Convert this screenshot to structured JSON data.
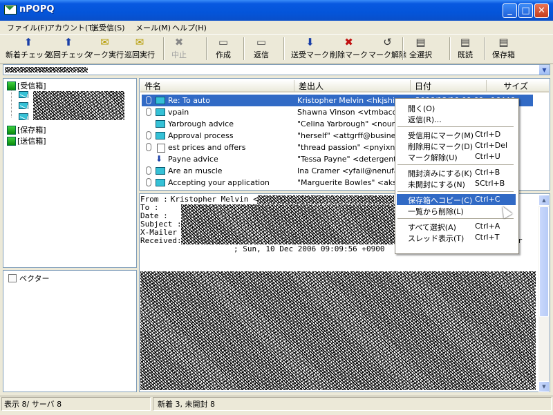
{
  "window": {
    "title": "nPOPQ",
    "minimize": "_",
    "maximize": "□",
    "close": "✕"
  },
  "menu": [
    "ファイル(F)",
    "アカウント(T)",
    "送受信(S)",
    "メール(M)",
    "ヘルプ(H)"
  ],
  "toolbar": [
    {
      "label": "新着チェック",
      "icon": "check-new-icon",
      "glyph": "⬆"
    },
    {
      "label": "巡回チェック",
      "icon": "round-check-icon",
      "glyph": "⬆"
    },
    {
      "label": "マーク実行",
      "icon": "execute-mark-icon",
      "glyph": "✉"
    },
    {
      "label": "巡回実行",
      "icon": "round-execute-icon",
      "glyph": "✉"
    },
    {
      "label": "中止",
      "icon": "stop-icon",
      "glyph": "✖",
      "disabled": true
    },
    {
      "label": "作成",
      "icon": "compose-icon",
      "glyph": "▭"
    },
    {
      "label": "返信",
      "icon": "reply-icon",
      "glyph": "▭"
    },
    {
      "label": "送受マーク",
      "icon": "send-receive-mark-icon",
      "glyph": "⬇"
    },
    {
      "label": "削除マーク",
      "icon": "delete-mark-icon",
      "glyph": "✖"
    },
    {
      "label": "マーク解除",
      "icon": "unmark-icon",
      "glyph": "↺"
    },
    {
      "label": "全選択",
      "icon": "select-all-icon",
      "glyph": "▤"
    },
    {
      "label": "既読",
      "icon": "mark-read-icon",
      "glyph": "▤"
    },
    {
      "label": "保存箱",
      "icon": "save-box-icon",
      "glyph": "▤"
    }
  ],
  "folders": {
    "inbox": "[受信箱]",
    "savebox": "[保存箱]",
    "outbox": "[送信箱]"
  },
  "vector_panel": {
    "label": "ベクター"
  },
  "list": {
    "columns": {
      "subject": "件名",
      "from": "差出人",
      "date": "日付",
      "size": "サイズ"
    },
    "rows": [
      {
        "attach": true,
        "icon": "mail",
        "subject": "Re: To auto",
        "from": "Kristopher Melvin <hkjshipme",
        "date": "2006/12/10 09:09",
        "size": "16446",
        "selected": true
      },
      {
        "attach": true,
        "icon": "mail",
        "subject": "vpain",
        "from": "Shawna Vinson <vtmbacon@",
        "date": "",
        "size": "",
        "selected": false
      },
      {
        "attach": false,
        "icon": "mail",
        "subject": "Yarbrough advice",
        "from": "\"Celina Yarbrough\" <nourish",
        "date": "",
        "size": "",
        "selected": false
      },
      {
        "attach": true,
        "icon": "mail",
        "subject": "Approval process",
        "from": "\"herself\" <attgrff@business",
        "date": "",
        "size": "",
        "selected": false
      },
      {
        "attach": true,
        "icon": "doc",
        "subject": "est prices and offers",
        "from": "\"thread passion\" <pnyixnxk",
        "date": "",
        "size": "",
        "selected": false
      },
      {
        "attach": false,
        "icon": "down",
        "subject": "Payne advice",
        "from": "\"Tessa Payne\" <detergent's",
        "date": "",
        "size": "",
        "selected": false
      },
      {
        "attach": true,
        "icon": "mail-down",
        "subject": "Are an muscle",
        "from": "Ina Cramer <yfail@nenufar.c",
        "date": "",
        "size": "",
        "selected": false
      },
      {
        "attach": true,
        "icon": "mail-down",
        "subject": "Accepting your application",
        "from": "\"Marguerite Bowles\" <akst",
        "date": "",
        "size": "",
        "selected": false
      }
    ]
  },
  "context_menu": [
    {
      "label": "開く(O)",
      "shortcut": ""
    },
    {
      "label": "返信(R)...",
      "shortcut": ""
    },
    {
      "sep": true
    },
    {
      "label": "受信用にマーク(M)",
      "shortcut": "Ctrl+D"
    },
    {
      "label": "削除用にマーク(D)",
      "shortcut": "Ctrl+Del"
    },
    {
      "label": "マーク解除(U)",
      "shortcut": "Ctrl+U"
    },
    {
      "sep": true
    },
    {
      "label": "開封済みにする(K)",
      "shortcut": "Ctrl+B"
    },
    {
      "label": "未開封にする(N)",
      "shortcut": "SCtrl+B"
    },
    {
      "sep": true
    },
    {
      "label": "保存箱へコピー(C)",
      "shortcut": "Ctrl+C",
      "highlight": true
    },
    {
      "label": "一覧から削除(L)",
      "shortcut": ""
    },
    {
      "sep": true
    },
    {
      "label": "すべて選択(A)",
      "shortcut": "Ctrl+A"
    },
    {
      "label": "スレッド表示(T)",
      "shortcut": "Ctrl+T"
    }
  ],
  "preview": {
    "headers": [
      {
        "label": "From     :",
        "value": "Kristopher Melvin <"
      },
      {
        "label": "To       :",
        "value": ""
      },
      {
        "label": "Date     :",
        "value": ""
      },
      {
        "label": "Subject  :",
        "value": ""
      },
      {
        "label": "X-Mailer :",
        "value": ""
      },
      {
        "label": "Received:",
        "value": ""
      }
    ],
    "received_tail": "; Sun, 10 Dec 2006 09:09:56 +0900",
    "received_tail2": "r"
  },
  "status": {
    "left": "表示 8/ サーバ 8",
    "right": "新着 3, 未開封 8"
  }
}
